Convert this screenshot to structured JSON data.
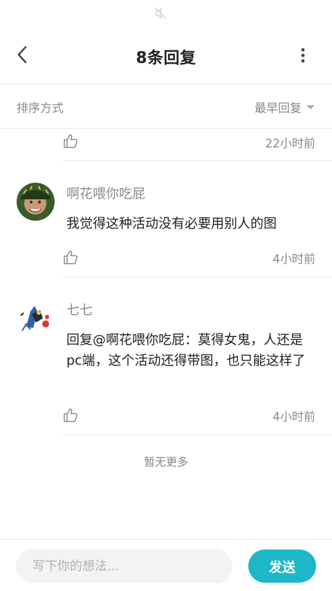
{
  "header": {
    "title": "8条回复"
  },
  "sort": {
    "label": "排序方式",
    "selected": "最早回复"
  },
  "top_item": {
    "time": "22小时前"
  },
  "comments": [
    {
      "username": "啊花喂你吃屁",
      "text": "我觉得这种活动没有必要用别人的图",
      "time": "4小时前"
    },
    {
      "username": "七七",
      "reply_prefix": "回复",
      "mention": "@啊花喂你吃屁",
      "text": "：莫得女鬼，人还是pc端，这个活动还得带图，也只能这样了",
      "time": "4小时前"
    }
  ],
  "footer_note": "暂无更多",
  "composer": {
    "placeholder": "写下你的想法...",
    "send_label": "发送"
  },
  "colors": {
    "accent": "#1cb8c9",
    "muted_text": "#888888",
    "divider": "#e6e6e6"
  },
  "icons": [
    "mute-icon",
    "back-icon",
    "more-icon",
    "caret-down-icon",
    "thumbs-up-icon"
  ]
}
